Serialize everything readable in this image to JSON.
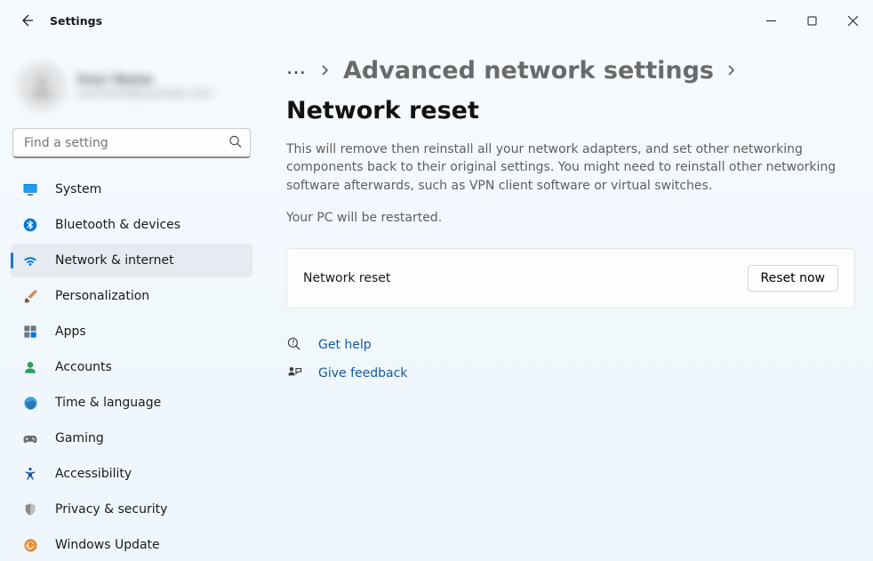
{
  "window": {
    "title": "Settings"
  },
  "account": {
    "display_name": "User Name",
    "email": "username@example.com"
  },
  "search": {
    "placeholder": "Find a setting"
  },
  "sidebar": {
    "items": [
      {
        "label": "System"
      },
      {
        "label": "Bluetooth & devices"
      },
      {
        "label": "Network & internet"
      },
      {
        "label": "Personalization"
      },
      {
        "label": "Apps"
      },
      {
        "label": "Accounts"
      },
      {
        "label": "Time & language"
      },
      {
        "label": "Gaming"
      },
      {
        "label": "Accessibility"
      },
      {
        "label": "Privacy & security"
      },
      {
        "label": "Windows Update"
      }
    ]
  },
  "breadcrumb": {
    "parent": "Advanced network settings",
    "current": "Network reset"
  },
  "main": {
    "description": "This will remove then reinstall all your network adapters, and set other networking components back to their original settings. You might need to reinstall other networking software afterwards, such as VPN client software or virtual switches.",
    "restart_note": "Your PC will be restarted.",
    "card_label": "Network reset",
    "reset_button": "Reset now",
    "help_link": "Get help",
    "feedback_link": "Give feedback"
  }
}
